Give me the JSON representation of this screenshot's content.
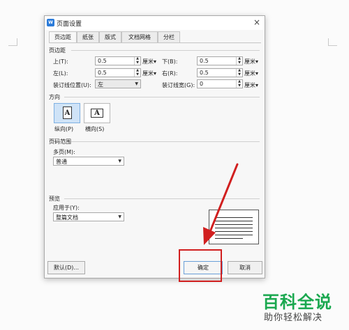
{
  "dialog": {
    "title": "页面设置",
    "app_icon": "wps-icon",
    "close": "×",
    "tabs": [
      {
        "label": "页边距",
        "active": true
      },
      {
        "label": "纸张",
        "active": false
      },
      {
        "label": "版式",
        "active": false
      },
      {
        "label": "文档网格",
        "active": false
      },
      {
        "label": "分栏",
        "active": false
      }
    ],
    "margins": {
      "section": "页边距",
      "top": {
        "label": "上(T):",
        "value": "0.5",
        "unit": "厘米▾"
      },
      "bottom": {
        "label": "下(B):",
        "value": "0.5",
        "unit": "厘米▾"
      },
      "left": {
        "label": "左(L):",
        "value": "0.5",
        "unit": "厘米▾"
      },
      "right": {
        "label": "右(R):",
        "value": "0.5",
        "unit": "厘米▾"
      },
      "gutter_pos": {
        "label": "装订线位置(U):",
        "value": "左"
      },
      "gutter_width": {
        "label": "装订线宽(G):",
        "value": "0",
        "unit": "厘米▾"
      }
    },
    "orientation": {
      "section": "方向",
      "portrait": {
        "label": "纵向(P)",
        "glyph": "A",
        "selected": true
      },
      "landscape": {
        "label": "横向(S)",
        "glyph": "A",
        "selected": false
      }
    },
    "pages": {
      "section": "页码范围",
      "multi_label": "多页(M):",
      "multi_value": "普通"
    },
    "preview": {
      "section": "预览",
      "apply_label": "应用于(Y):",
      "apply_value": "整篇文档"
    },
    "buttons": {
      "default": "默认(D)...",
      "ok": "确定",
      "cancel": "取消"
    }
  },
  "annotation": {
    "arrow_color": "#d11f1f",
    "box_color": "#d11f1f"
  },
  "watermark": {
    "line1": "百科全说",
    "line2": "助你轻松解决",
    "color": "#1aa84f"
  }
}
